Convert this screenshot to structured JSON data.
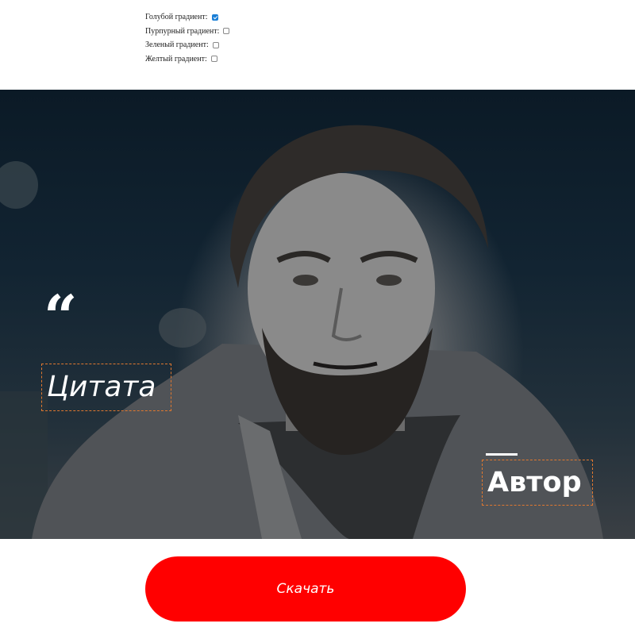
{
  "gradients": [
    {
      "label": "Голубой градиент:",
      "checked": true
    },
    {
      "label": "Пурпурный градиент:",
      "checked": false
    },
    {
      "label": "Зеленый градиент:",
      "checked": false
    },
    {
      "label": "Желтый градиент:",
      "checked": false
    }
  ],
  "card": {
    "quote_mark": "“",
    "quote_text": "Цитата",
    "author_text": "Автор"
  },
  "download_label": "Скачать",
  "colors": {
    "button": "#ff0000",
    "checkbox_accent": "#1b7fd6",
    "dashed_border": "#e0782f"
  }
}
